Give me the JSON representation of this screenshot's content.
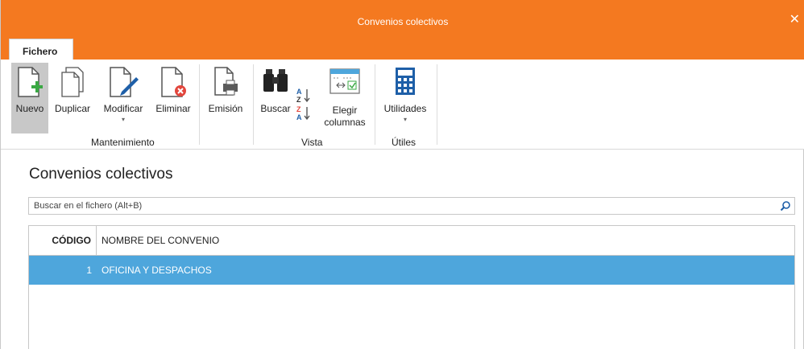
{
  "window": {
    "title": "Convenios colectivos",
    "close_label": "✕"
  },
  "tabs": [
    {
      "label": "Fichero"
    }
  ],
  "ribbon": {
    "buttons": [
      {
        "label": "Nuevo",
        "icon": "new-document-icon"
      },
      {
        "label": "Duplicar",
        "icon": "duplicate-icon"
      },
      {
        "label": "Modificar",
        "icon": "edit-document-icon",
        "dropdown": true
      },
      {
        "label": "Eliminar",
        "icon": "delete-document-icon"
      },
      {
        "label": "Emisión",
        "icon": "printer-document-icon"
      },
      {
        "label": "Buscar",
        "icon": "binoculars-icon"
      },
      {
        "label": "Elegir columnas",
        "line1": "Elegir",
        "line2": "columnas",
        "icon": "choose-columns-icon"
      },
      {
        "label": "Utilidades",
        "icon": "calculator-icon",
        "dropdown": true
      }
    ],
    "groups": [
      {
        "label": "Mantenimiento"
      },
      {
        "label": "Vista"
      },
      {
        "label": "Útiles"
      }
    ],
    "sort_icons": [
      "sort-az-icon",
      "sort-za-icon"
    ]
  },
  "main": {
    "page_title": "Convenios colectivos",
    "search_placeholder": "Buscar en el fichero (Alt+B)",
    "columns": [
      "CÓDIGO",
      "NOMBRE DEL CONVENIO"
    ],
    "rows": [
      {
        "code": "1",
        "name": "OFICINA Y DESPACHOS"
      }
    ]
  },
  "colors": {
    "accent": "#f47920",
    "selection": "#4ea6dc"
  }
}
